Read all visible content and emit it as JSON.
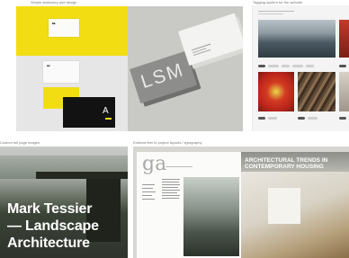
{
  "tiles": [
    {
      "caption": "Simple stationery and design"
    },
    {
      "caption": ""
    },
    {
      "caption": "Tagging system for the website"
    },
    {
      "caption": "Custom full page images",
      "title_lines": [
        "Mark Tessier",
        "— Landscape",
        "Architecture"
      ]
    },
    {
      "caption": "Editorial feel to project layouts / typography",
      "logo": "ga",
      "heading_lines": [
        "ARCHITECTURAL TRENDS IN",
        "CONTEMPORARY HOUSING"
      ]
    }
  ],
  "lsm_text": "LSM",
  "card_letter": "A",
  "colors": {
    "accent_yellow": "#f2dd13",
    "card_black": "#121212",
    "card_grey": "#8d8e8b"
  }
}
